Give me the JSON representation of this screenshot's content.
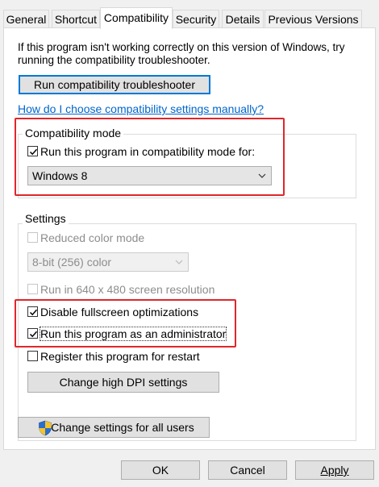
{
  "tabs": [
    {
      "label": "General"
    },
    {
      "label": "Shortcut"
    },
    {
      "label": "Compatibility"
    },
    {
      "label": "Security"
    },
    {
      "label": "Details"
    },
    {
      "label": "Previous Versions"
    }
  ],
  "intro": {
    "line1": "If this program isn't working correctly on this version of Windows, try",
    "line2": "running the compatibility troubleshooter."
  },
  "troubleshooter_button": "Run compatibility troubleshooter",
  "help_link": "How do I choose compatibility settings manually?",
  "compat_mode": {
    "title": "Compatibility mode",
    "checkbox_label": "Run this program in compatibility mode for:",
    "checked": true,
    "selected_os": "Windows 8"
  },
  "settings": {
    "title": "Settings",
    "reduced_color": {
      "label": "Reduced color mode",
      "checked": false
    },
    "color_select": "8-bit (256) color",
    "res_640": {
      "label": "Run in 640 x 480 screen resolution",
      "checked": false
    },
    "disable_fullscreen": {
      "label": "Disable fullscreen optimizations",
      "checked": true
    },
    "run_as_admin": {
      "label": "Run this program as an administrator",
      "checked": true
    },
    "register_restart": {
      "label": "Register this program for restart",
      "checked": false
    },
    "dpi_button": "Change high DPI settings"
  },
  "all_users_button": "Change settings for all users",
  "footer": {
    "ok": "OK",
    "cancel": "Cancel",
    "apply": "Apply"
  },
  "colors": {
    "highlight": "#e0262b",
    "link": "#0066cc",
    "focus": "#0078d7"
  },
  "icons": {
    "checkmark": "checkmark-icon",
    "chevron": "chevron-down-icon",
    "shield": "uac-shield-icon"
  }
}
